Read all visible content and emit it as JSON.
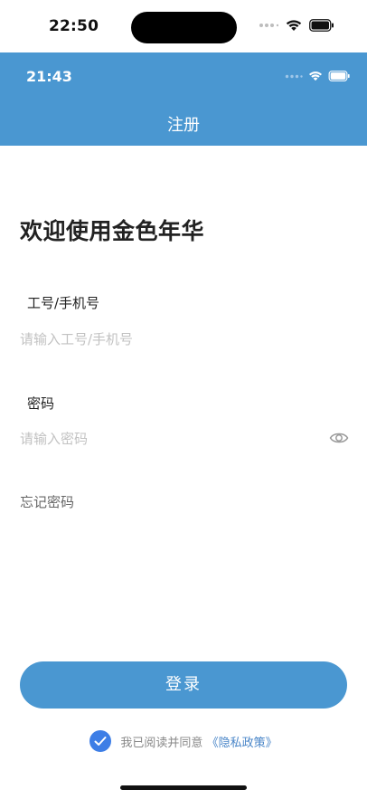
{
  "device_status": {
    "time": "22:50",
    "icons": [
      "signal-dots-icon",
      "wifi-icon",
      "battery-icon"
    ]
  },
  "app_status": {
    "time": "21:43",
    "icons": [
      "signal-dots-icon",
      "wifi-icon",
      "battery-icon"
    ]
  },
  "nav": {
    "title": "注册"
  },
  "welcome": "欢迎使用金色年华",
  "account_field": {
    "label": "工号/手机号",
    "placeholder": "请输入工号/手机号",
    "value": ""
  },
  "password_field": {
    "label": "密码",
    "placeholder": "请输入密码",
    "value": "",
    "toggle_icon": "eye-icon"
  },
  "forgot_password": "忘记密码",
  "login_button": "登录",
  "agreement": {
    "checked": true,
    "text": "我已阅读并同意",
    "link": "《隐私政策》"
  },
  "colors": {
    "primary": "#4a97d1",
    "checkbox": "#3d7ee6",
    "link": "#4a86c8",
    "placeholder": "#c2c2c2"
  }
}
